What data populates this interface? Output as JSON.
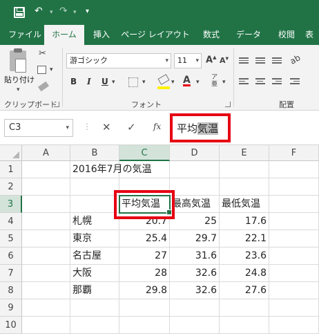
{
  "ribbon_tabs": [
    "ファイル",
    "ホーム",
    "挿入",
    "ページ レイアウト",
    "数式",
    "データ",
    "校閲",
    "表"
  ],
  "active_tab": "ホーム",
  "clipboard": {
    "paste_label": "貼り付け",
    "group_label": "クリップボード"
  },
  "font": {
    "name": "游ゴシック",
    "size": "11",
    "group_label": "フォント",
    "bold": "B",
    "italic": "I",
    "underline": "U"
  },
  "alignment": {
    "group_label": "配置"
  },
  "formula_bar": {
    "name_box": "C3",
    "fx": "fx",
    "formula_plain": "平均",
    "formula_highlight": "気温"
  },
  "columns": [
    "A",
    "B",
    "C",
    "D",
    "E",
    "F"
  ],
  "rows": [
    "1",
    "2",
    "3",
    "4",
    "5",
    "6",
    "7",
    "8",
    "9",
    "10"
  ],
  "cells": {
    "B1": "2016年7月の気温",
    "C3": "平均気温",
    "D3": "最高気温",
    "E3": "最低気温",
    "B4": "札幌",
    "C4": "20.7",
    "D4": "25",
    "E4": "17.6",
    "B5": "東京",
    "C5": "25.4",
    "D5": "29.7",
    "E5": "22.1",
    "B6": "名古屋",
    "C6": "27",
    "D6": "31.6",
    "E6": "23.6",
    "B7": "大阪",
    "C7": "28",
    "D7": "32.6",
    "E7": "24.8",
    "B8": "那覇",
    "C8": "29.8",
    "D8": "32.6",
    "E8": "27.6"
  },
  "icons": {
    "undo": "↶",
    "redo": "↷",
    "cancel": "✕",
    "enter": "✓",
    "cut": "✂",
    "dropdown": "▾"
  },
  "colors": {
    "excel_green": "#217346",
    "highlight_red": "#e60012",
    "font_color_red": "#e60012"
  }
}
